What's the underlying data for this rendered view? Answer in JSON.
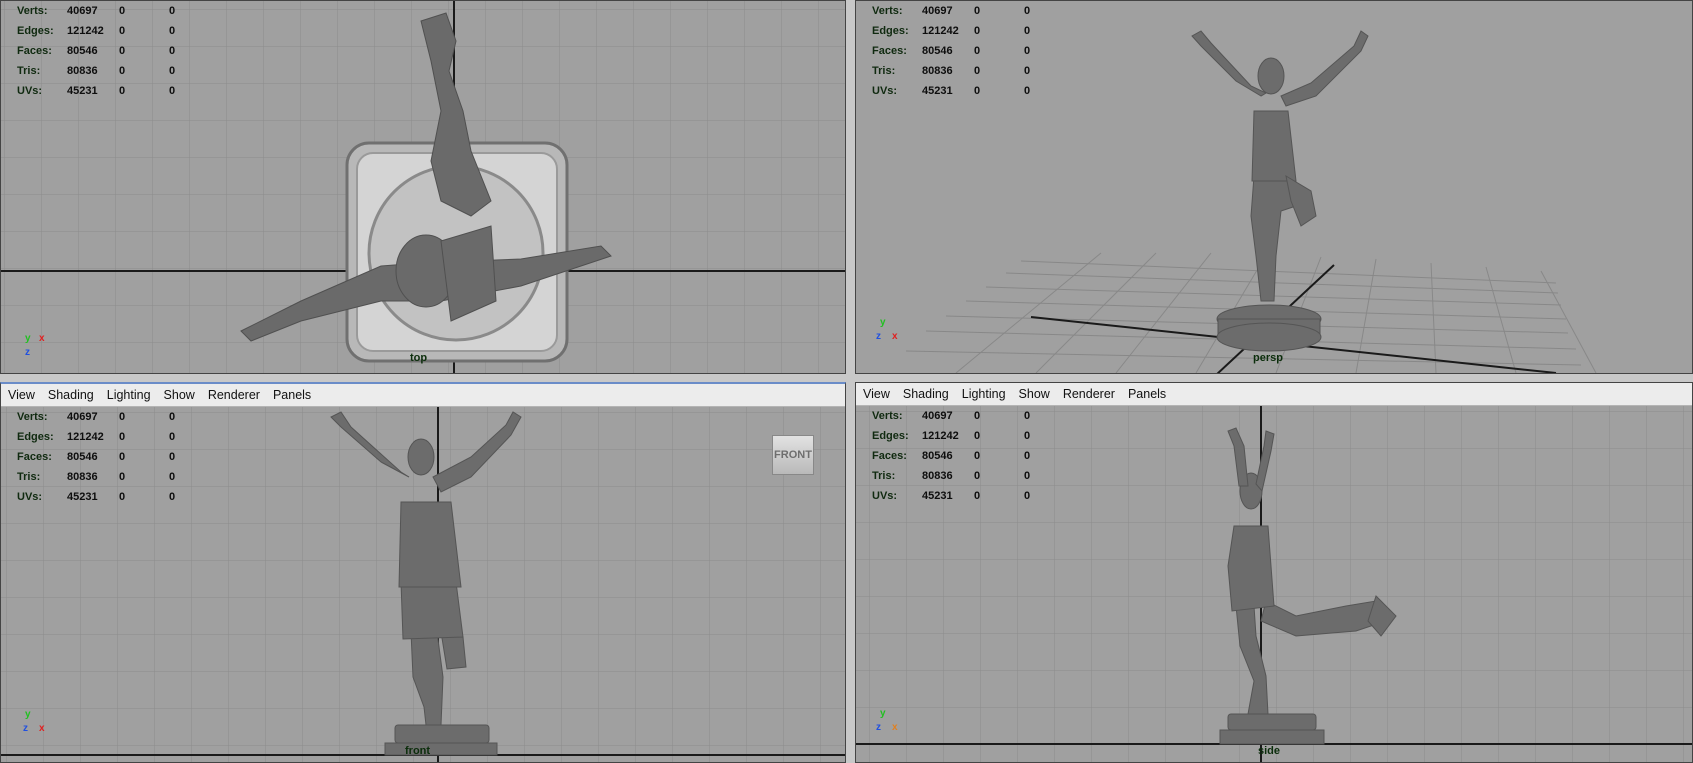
{
  "menu": [
    "View",
    "Shading",
    "Lighting",
    "Show",
    "Renderer",
    "Panels"
  ],
  "hud": {
    "labels": [
      "Verts:",
      "Edges:",
      "Faces:",
      "Tris:",
      "UVs:"
    ],
    "values": [
      "40697",
      "121242",
      "80546",
      "80836",
      "45231"
    ],
    "zeros": [
      "0",
      "0",
      "0",
      "0",
      "0"
    ]
  },
  "views": {
    "top": "top",
    "persp": "persp",
    "front": "front",
    "side": "side"
  },
  "viewcube_label": "FRONT",
  "axes": {
    "x": "x",
    "y": "y",
    "z": "z"
  },
  "colors": {
    "viewport_bg": "#a0a0a0",
    "grid": "#8a8a8a",
    "axis_line": "#1a1a1a",
    "mesh": "#6c6c6c",
    "x_axis": "#e02020",
    "y_axis": "#20c020",
    "z_axis": "#2050e0"
  }
}
